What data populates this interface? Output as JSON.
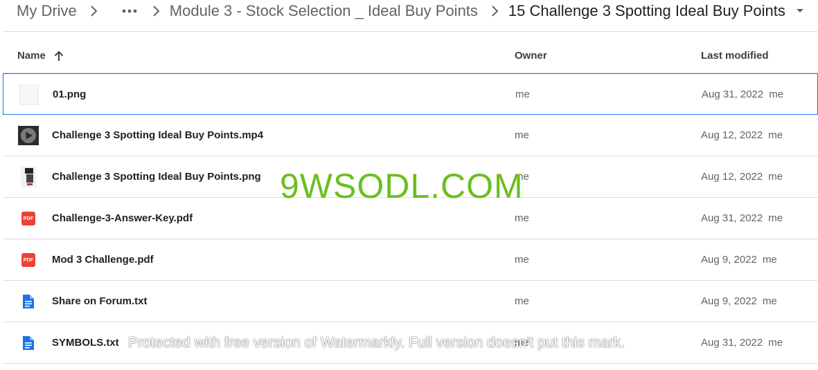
{
  "breadcrumb": {
    "root": "My Drive",
    "more_icon": "more-horiz-icon",
    "parent": "Module 3 - Stock Selection _ Ideal Buy Points",
    "current": "15 Challenge 3 Spotting Ideal Buy Points"
  },
  "columns": {
    "name": "Name",
    "owner": "Owner",
    "modified": "Last modified"
  },
  "files": [
    {
      "name": "01.png",
      "owner": "me",
      "date": "Aug 31, 2022",
      "by": "me",
      "icon": "image-thumbnail-icon"
    },
    {
      "name": "Challenge 3 Spotting Ideal Buy Points.mp4",
      "owner": "me",
      "date": "Aug 12, 2022",
      "by": "me",
      "icon": "video-thumbnail-icon"
    },
    {
      "name": "Challenge 3 Spotting Ideal Buy Points.png",
      "owner": "me",
      "date": "Aug 12, 2022",
      "by": "me",
      "icon": "image-thumbnail-icon"
    },
    {
      "name": "Challenge-3-Answer-Key.pdf",
      "owner": "me",
      "date": "Aug 31, 2022",
      "by": "me",
      "icon": "pdf-icon",
      "badge": "PDF"
    },
    {
      "name": "Mod 3 Challenge.pdf",
      "owner": "me",
      "date": "Aug 9, 2022",
      "by": "me",
      "icon": "pdf-icon",
      "badge": "PDF"
    },
    {
      "name": "Share on Forum.txt",
      "owner": "me",
      "date": "Aug 9, 2022",
      "by": "me",
      "icon": "document-icon"
    },
    {
      "name": "SYMBOLS.txt",
      "owner": "me",
      "date": "Aug 31, 2022",
      "by": "me",
      "icon": "document-icon"
    }
  ],
  "watermarks": {
    "main": "9WSODL.COM",
    "sub": "Protected with free version of Watermarkly. Full version doesn't put this mark."
  },
  "colors": {
    "selection": "#1a73e8",
    "pdf": "#ea4335",
    "doc": "#1a73e8",
    "watermark": "#6abf1e"
  }
}
